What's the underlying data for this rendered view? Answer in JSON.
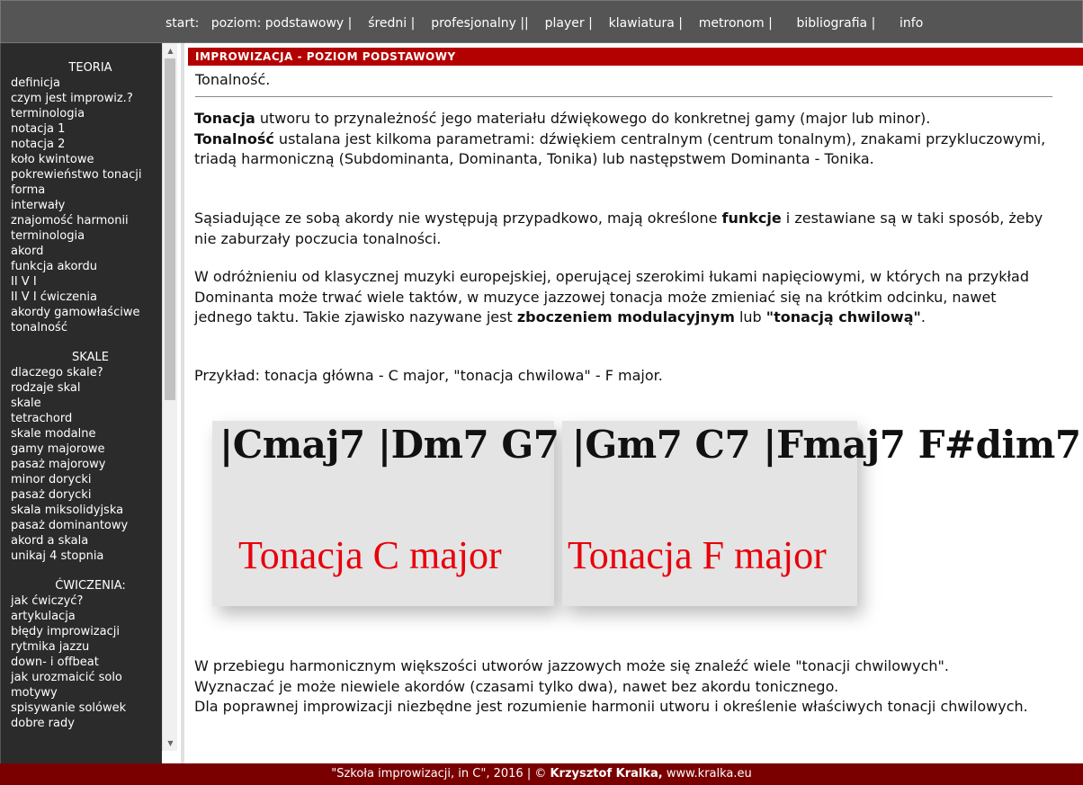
{
  "nav": {
    "start": "start:",
    "items": [
      "poziom: podstawowy",
      "średni",
      "profesjonalny",
      "player",
      "klawiatura",
      "metronom",
      "bibliografia",
      "info"
    ],
    "seps": [
      "|",
      "|",
      "||",
      "|",
      "|",
      "|",
      "|"
    ]
  },
  "sidebar": {
    "teoria_title": "TEORIA",
    "teoria": [
      "definicja",
      "czym jest improwiz.?",
      "terminologia",
      "notacja 1",
      "notacja 2",
      "koło kwintowe",
      "pokrewieństwo tonacji",
      "forma",
      "interwały",
      "znajomość harmonii",
      "terminologia",
      "akord",
      "funkcja akordu",
      "II V I",
      "II V I ćwiczenia",
      "akordy gamowłaściwe",
      "tonalność"
    ],
    "skale_title": "SKALE",
    "skale": [
      "dlaczego skale?",
      "rodzaje skal",
      "skale",
      "tetrachord",
      "skale modalne",
      "gamy majorowe",
      "pasaż majorowy",
      "minor dorycki",
      "pasaż dorycki",
      "skala miksolidyjska",
      "pasaż dominantowy",
      "akord a skala",
      "unikaj 4 stopnia"
    ],
    "cwiczenia_title": "ĆWICZENIA:",
    "cwiczenia": [
      "jak ćwiczyć?",
      "artykulacja",
      "błędy improwizacji",
      "rytmika jazzu",
      "down- i offbeat",
      "jak urozmaicić solo",
      "motywy",
      "spisywanie solówek",
      "dobre rady"
    ]
  },
  "content": {
    "banner": "IMPROWIZACJA - POZIOM PODSTAWOWY",
    "title": "Tonalność.",
    "p1": {
      "b1": "Tonacja",
      "t1": " utworu to przynależność jego materiału dźwiękowego do konkretnej gamy (major lub minor).",
      "b2": "Tonalność",
      "t2": " ustalana jest kilkoma parametrami: dźwiękiem centralnym (centrum tonalnym), znakami przykluczowymi, triadą harmoniczną (Subdominanta, Dominanta, Tonika) lub następstwem Dominanta - Tonika."
    },
    "p2": {
      "t1": "Sąsiadujące ze sobą akordy nie występują przypadkowo, mają określone ",
      "b1": "funkcje",
      "t2": " i zestawiane są w taki sposób, żeby nie zaburzały poczucia tonalności."
    },
    "p3": {
      "t1": "W odróżnieniu od klasycznej muzyki europejskiej, operującej szerokimi łukami napięciowymi, w których na przykład Dominanta może trwać wiele taktów, w muzyce jazzowej tonacja może zmieniać się na krótkim odcinku, nawet jednego taktu. Takie zjawisko nazywane jest ",
      "b1": "zboczeniem modulacyjnym",
      "t2": " lub ",
      "b2": "\"tonacją chwilową\"",
      "t3": "."
    },
    "p4": "Przykład: tonacja główna - C major, \"tonacja chwilowa\" - F major.",
    "chords": "|Cmaj7   |Dm7 G7 |Gm7 C7 |Fmaj7 F#dim7 |",
    "tonacja_c": "Tonacja C major",
    "tonacja_f": "Tonacja F major",
    "p5a": "W przebiegu harmonicznym większości utworów jazzowych może się znaleźć wiele \"tonacji chwilowych\".",
    "p5b": "Wyznaczać je może niewiele akordów (czasami tylko dwa), nawet bez akordu tonicznego.",
    "p5c": "Dla poprawnej improwizacji niezbędne jest rozumienie harmonii utworu i określenie właściwych tonacji chwilowych."
  },
  "footer": {
    "t1": "\"Szkoła improwizacji, in C\", 2016 | © ",
    "author": "Krzysztof Kralka,",
    "t2": " www.kralka.eu"
  },
  "colors": {
    "banner": "#b30000",
    "footer": "#7a0000",
    "tonacja": "#e8000b",
    "nav_bg": "#555555",
    "sidebar_bg": "#2b2b2b"
  }
}
